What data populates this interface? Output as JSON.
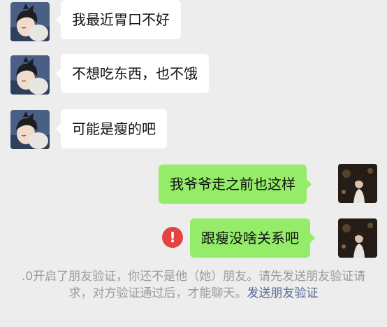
{
  "messages": [
    {
      "side": "left",
      "text": "我最近胃口不好"
    },
    {
      "side": "left",
      "text": "不想吃东西，也不饿"
    },
    {
      "side": "left",
      "text": "可能是瘦的吧"
    },
    {
      "side": "right",
      "text": "我爷爷走之前也这样"
    },
    {
      "side": "right",
      "text": "跟瘦没啥关系吧",
      "failed": true
    }
  ],
  "error_icon": {
    "glyph": "!",
    "color": "#e64340"
  },
  "system_notice": {
    "text": ".0开启了朋友验证，你还不是他（她）朋友。请先发送朋友验证请求，对方验证通过后，才能聊天。",
    "link": "发送朋友验证"
  },
  "colors": {
    "background": "#ededed",
    "incoming_bubble": "#ffffff",
    "outgoing_bubble": "#95ec69",
    "notice_text": "#9b9b9b",
    "link": "#576b95"
  }
}
